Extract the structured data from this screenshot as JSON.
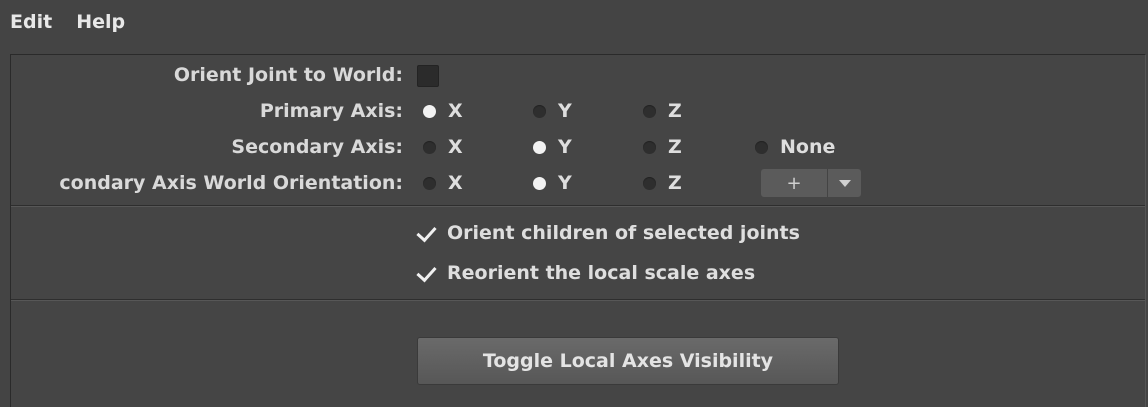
{
  "menubar": {
    "items": [
      "Edit",
      "Help"
    ]
  },
  "orient_to_world": {
    "label": "Orient Joint to World:",
    "checked": false
  },
  "primary_axis": {
    "label": "Primary Axis:",
    "options": [
      "X",
      "Y",
      "Z"
    ],
    "selected": "X"
  },
  "secondary_axis": {
    "label": "Secondary Axis:",
    "options": [
      "X",
      "Y",
      "Z",
      "None"
    ],
    "selected": "Y"
  },
  "secondary_world": {
    "label": "condary Axis World Orientation:",
    "options": [
      "X",
      "Y",
      "Z"
    ],
    "selected": "Y",
    "split_button_symbol": "+",
    "split_button_icon": "dropdown-triangle"
  },
  "options": {
    "orient_children": {
      "label": "Orient children of selected joints",
      "checked": true
    },
    "reorient_scale": {
      "label": "Reorient the local scale axes",
      "checked": true
    }
  },
  "toggle_button": {
    "label": "Toggle Local Axes Visibility"
  },
  "colors": {
    "background": "#444444",
    "text": "#dddddd",
    "radio_on": "#f2f2f2",
    "radio_off": "#2e2e2e"
  }
}
